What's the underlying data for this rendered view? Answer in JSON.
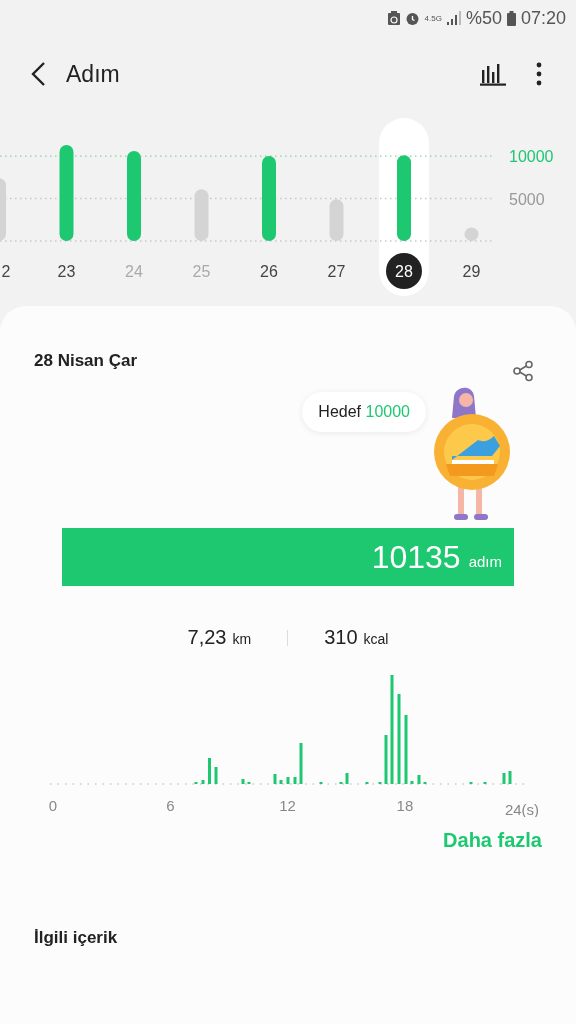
{
  "status_bar": {
    "network": "4.5G",
    "battery": "%50",
    "time": "07:20"
  },
  "header": {
    "title": "Adım"
  },
  "week_chart": {
    "chart_data": {
      "type": "bar",
      "categories": [
        "2",
        "23",
        "24",
        "25",
        "26",
        "27",
        "28",
        "29"
      ],
      "series": [
        {
          "color": "#1dc870",
          "values": [
            null,
            11300,
            10600,
            null,
            10000,
            null,
            10100,
            null
          ]
        },
        {
          "color": "#d4d4d4",
          "values": [
            7400,
            null,
            null,
            6100,
            null,
            4900,
            null,
            1600
          ]
        }
      ],
      "ylim": [
        0,
        11300
      ],
      "ref_lines": [
        {
          "axis": "y",
          "value": 10000,
          "color": "#7fd6a5"
        },
        {
          "axis": "y",
          "value": 5000,
          "color": "#c8c8c8"
        }
      ],
      "yticks": [
        {
          "value": 5000,
          "label": "5000"
        },
        {
          "value": 10000,
          "label": "10000"
        }
      ]
    },
    "days": [
      {
        "selected": false,
        "dimmed": false
      },
      {
        "selected": false,
        "dimmed": false
      },
      {
        "selected": false,
        "dimmed": true
      },
      {
        "selected": false,
        "dimmed": true
      },
      {
        "selected": false,
        "dimmed": false
      },
      {
        "selected": false,
        "dimmed": false
      },
      {
        "selected": true,
        "dimmed": false
      },
      {
        "selected": false,
        "dimmed": false
      }
    ]
  },
  "card": {
    "date": "28 Nisan Çar",
    "goal_label": "Hedef",
    "goal_value": "10000",
    "progress": {
      "level": 1,
      "value": "10135",
      "unit": "adım"
    },
    "stats": [
      {
        "value": "7,23",
        "unit": "km"
      },
      {
        "value": "310",
        "unit": "kcal"
      }
    ],
    "hourly_axis": [
      "0",
      "6",
      "12",
      "18",
      "24(s)"
    ],
    "more": "Daha fazla"
  },
  "related": {
    "title": "İlgili içerik"
  }
}
